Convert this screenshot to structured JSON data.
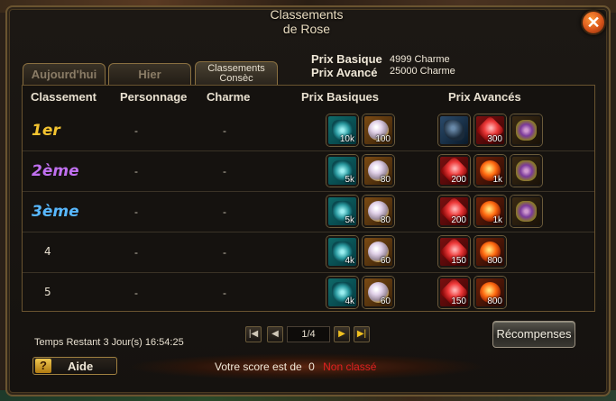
{
  "window": {
    "title_line1": "Classements",
    "title_line2": "de Rose",
    "close_glyph": "✕"
  },
  "tabs": [
    {
      "label": "Aujourd'hui",
      "active": false
    },
    {
      "label": "Hier",
      "active": false
    },
    {
      "label_line1": "Classements",
      "label_line2": "Consèc",
      "active": true
    }
  ],
  "prize_info": {
    "basic_label": "Prix Basique",
    "basic_value": "4999 Charme",
    "advanced_label": "Prix Avancé",
    "advanced_value": "25000 Charme"
  },
  "table": {
    "headers": {
      "rank": "Classement",
      "character": "Personnage",
      "charm": "Charme",
      "basic": "Prix Basiques",
      "advanced": "Prix Avancés"
    },
    "rows": [
      {
        "rank": "1er",
        "character": "-",
        "charm": "-",
        "basic": [
          {
            "icon": "wing-icon",
            "qty": "10k"
          },
          {
            "icon": "pearl-icon",
            "qty": "100"
          }
        ],
        "advanced": [
          {
            "icon": "horse-mount-icon",
            "qty": ""
          },
          {
            "icon": "red-crystal-icon",
            "qty": "300"
          },
          {
            "icon": "rune-orb-icon",
            "qty": ""
          }
        ]
      },
      {
        "rank": "2ème",
        "character": "-",
        "charm": "-",
        "basic": [
          {
            "icon": "wing-icon",
            "qty": "5k"
          },
          {
            "icon": "pearl-icon",
            "qty": "80"
          }
        ],
        "advanced": [
          {
            "icon": "red-crystal-icon",
            "qty": "200"
          },
          {
            "icon": "fire-orb-icon",
            "qty": "1k"
          },
          {
            "icon": "rune-orb-icon",
            "qty": ""
          }
        ]
      },
      {
        "rank": "3ème",
        "character": "-",
        "charm": "-",
        "basic": [
          {
            "icon": "wing-icon",
            "qty": "5k"
          },
          {
            "icon": "pearl-icon",
            "qty": "80"
          }
        ],
        "advanced": [
          {
            "icon": "red-crystal-icon",
            "qty": "200"
          },
          {
            "icon": "fire-orb-icon",
            "qty": "1k"
          },
          {
            "icon": "rune-orb-icon",
            "qty": ""
          }
        ]
      },
      {
        "rank": "4",
        "character": "-",
        "charm": "-",
        "basic": [
          {
            "icon": "wing-icon",
            "qty": "4k"
          },
          {
            "icon": "pearl-icon",
            "qty": "60"
          }
        ],
        "advanced": [
          {
            "icon": "red-crystal-icon",
            "qty": "150"
          },
          {
            "icon": "fire-orb-icon",
            "qty": "800"
          }
        ]
      },
      {
        "rank": "5",
        "character": "-",
        "charm": "-",
        "basic": [
          {
            "icon": "wing-icon",
            "qty": "4k"
          },
          {
            "icon": "pearl-icon",
            "qty": "60"
          }
        ],
        "advanced": [
          {
            "icon": "red-crystal-icon",
            "qty": "150"
          },
          {
            "icon": "fire-orb-icon",
            "qty": "800"
          }
        ]
      }
    ]
  },
  "rank_colors": {
    "first": "#f4c430",
    "second": "#c070f0",
    "third": "#58b8ff"
  },
  "timer": {
    "label": "Temps Restant",
    "value": "3 Jour(s)  16:54:25"
  },
  "pager": {
    "first": "|◀",
    "prev": "◀",
    "page": "1/4",
    "next": "▶",
    "last": "▶|"
  },
  "rewards_button": "Récompenses",
  "help": {
    "icon": "?",
    "label": "Aide"
  },
  "score": {
    "label": "Votre score est de",
    "value": "0",
    "status": "Non classé"
  }
}
